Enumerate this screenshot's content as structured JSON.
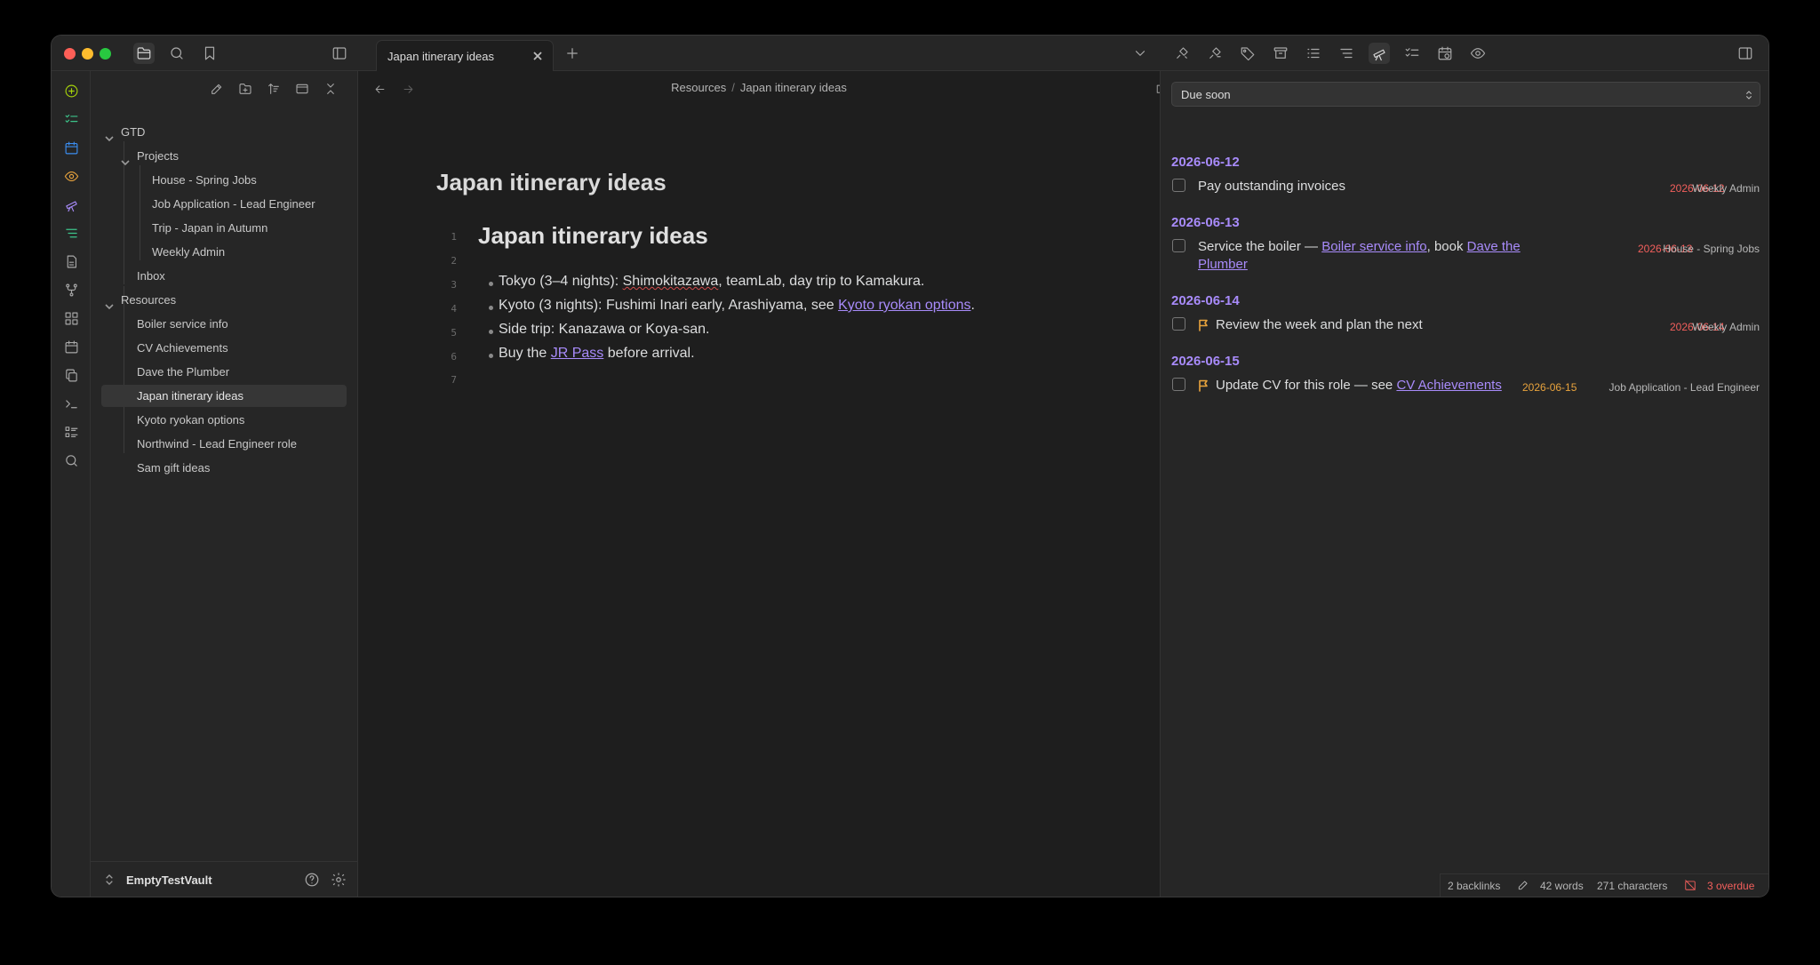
{
  "tab": {
    "title": "Japan itinerary ideas"
  },
  "breadcrumb": {
    "parent": "Resources",
    "separator": "/",
    "current": "Japan itinerary ideas"
  },
  "file_tree": {
    "items": [
      {
        "label": "GTD",
        "kind": "folder",
        "expanded": true
      },
      {
        "label": "Projects",
        "kind": "folder",
        "expanded": true
      },
      {
        "label": "House - Spring Jobs",
        "kind": "file"
      },
      {
        "label": "Job Application - Lead Engineer",
        "kind": "file"
      },
      {
        "label": "Trip - Japan in Autumn",
        "kind": "file"
      },
      {
        "label": "Weekly Admin",
        "kind": "file"
      },
      {
        "label": "Inbox",
        "kind": "file"
      },
      {
        "label": "Resources",
        "kind": "folder",
        "expanded": true
      },
      {
        "label": "Boiler service info",
        "kind": "file"
      },
      {
        "label": "CV Achievements",
        "kind": "file"
      },
      {
        "label": "Dave the Plumber",
        "kind": "file"
      },
      {
        "label": "Japan itinerary ideas",
        "kind": "file",
        "selected": true
      },
      {
        "label": "Kyoto ryokan options",
        "kind": "file"
      },
      {
        "label": "Northwind - Lead Engineer role",
        "kind": "file"
      },
      {
        "label": "Sam gift ideas",
        "kind": "file"
      }
    ]
  },
  "vault": {
    "name": "EmptyTestVault"
  },
  "note": {
    "inline_title": "Japan itinerary ideas",
    "line_numbers": [
      "1",
      "2",
      "3",
      "4",
      "5",
      "6",
      "7"
    ],
    "heading": "Japan itinerary ideas",
    "bullets": [
      {
        "prefix": "Tokyo (3–4 nights): ",
        "squiggle": "Shimokitazawa",
        "rest": ", teamLab, day trip to Kamakura."
      },
      {
        "prefix": "Kyoto (3 nights): Fushimi Inari early, Arashiyama, see ",
        "link": "Kyoto ryokan options",
        "suffix": "."
      },
      {
        "text": "Side trip: Kanazawa or Koya-san."
      },
      {
        "prefix": "Buy the ",
        "link": "JR Pass",
        "suffix": " before arrival."
      }
    ]
  },
  "tasks_panel": {
    "filter": "Due soon",
    "groups": [
      {
        "date": "2026-06-12",
        "task": "Pay outstanding invoices",
        "due": "2026-06-12",
        "project": "Weekly Admin"
      },
      {
        "date": "2026-06-13",
        "task_prefix": "Service the boiler — ",
        "link1": "Boiler service info",
        "middle": ", book ",
        "link2_line1": "Dave the",
        "link2_line2": "Plumber",
        "due": "2026-06-13",
        "project": "House - Spring Jobs"
      },
      {
        "date": "2026-06-14",
        "task": "Review the week and plan the next",
        "due": "2026-06-14",
        "project": "Weekly Admin"
      },
      {
        "date": "2026-06-15",
        "task_prefix": "Update CV for this role — see ",
        "link1": "CV Achievements",
        "due": "2026-06-15",
        "project": "Job Application - Lead Engineer"
      }
    ]
  },
  "status_bar": {
    "backlinks": "2 backlinks",
    "words": "42 words",
    "characters": "271 characters",
    "overdue": "3 overdue"
  },
  "colors": {
    "accent": "#a88bfa",
    "overdue": "#f25f5c",
    "due_upcoming": "#e8a33d"
  }
}
